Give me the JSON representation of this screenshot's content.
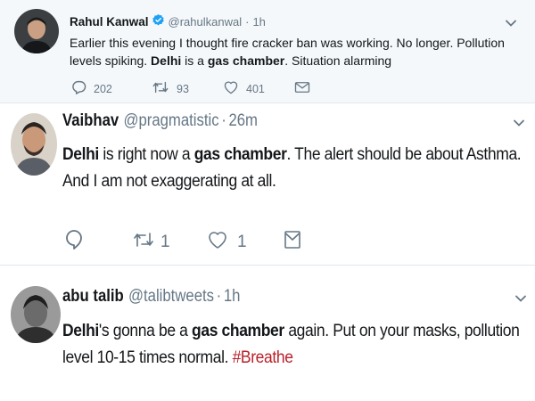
{
  "tweets": [
    {
      "name": "Rahul Kanwal",
      "handle": "@rahulkanwal",
      "separator": "·",
      "time": "1h",
      "verified": true,
      "text_parts": {
        "p1": "Earlier this evening I thought fire cracker ban was working. No longer. Pollution levels spiking. ",
        "b1": "Delhi",
        "p2": " is a ",
        "b2": "gas chamber",
        "p3": ". Situation alarming"
      },
      "replies": "202",
      "retweets": "93",
      "likes": "401"
    },
    {
      "name": "Vaibhav",
      "handle": "@pragmatistic",
      "separator": "·",
      "time": "26m",
      "text_parts": {
        "b1": "Delhi",
        "p1": " is right now a ",
        "b2": "gas chamber",
        "p2": ". The alert should be about Asthma. And I am not exaggerating at all."
      },
      "retweets": "1",
      "likes": "1"
    },
    {
      "name": "abu talib",
      "handle": "@talibtweets",
      "separator": "·",
      "time": "1h",
      "text_parts": {
        "b1": "Delhi",
        "p1": "'s gonna be a ",
        "b2": "gas chamber",
        "p2": " again. Put on your masks, pollution level 10-15 times normal. ",
        "hashtag": "#Breathe"
      }
    }
  ],
  "colors": {
    "verified_blue": "#1da1f2",
    "secondary_text": "#657786",
    "hashtag": "#b8202a",
    "highlight_bg": "#f5f8fa"
  },
  "icons": [
    "verified-badge-icon",
    "reply-icon",
    "retweet-icon",
    "like-icon",
    "direct-message-icon",
    "caret-down-icon"
  ]
}
